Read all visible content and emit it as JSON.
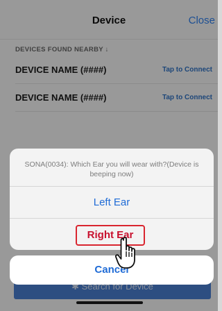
{
  "header": {
    "title": "Device",
    "close_label": "Close"
  },
  "devices": {
    "section_title": "DEVICES FOUND NEARBY ↓",
    "rows": [
      {
        "name": "DEVICE NAME (####)",
        "action": "Tap to Connect"
      },
      {
        "name": "DEVICE NAME (####)",
        "action": "Tap to Connect"
      }
    ]
  },
  "search_button": {
    "label": "Search for Device",
    "icon": "bluetooth-icon"
  },
  "action_sheet": {
    "message": "SONA(0034): Which Ear you will wear with?(Device is beeping now)",
    "left_label": "Left Ear",
    "right_label": "Right Ear",
    "cancel_label": "Cancel",
    "highlight_color": "#d9252f"
  },
  "pointer": {
    "icon": "pointing-hand-icon"
  }
}
